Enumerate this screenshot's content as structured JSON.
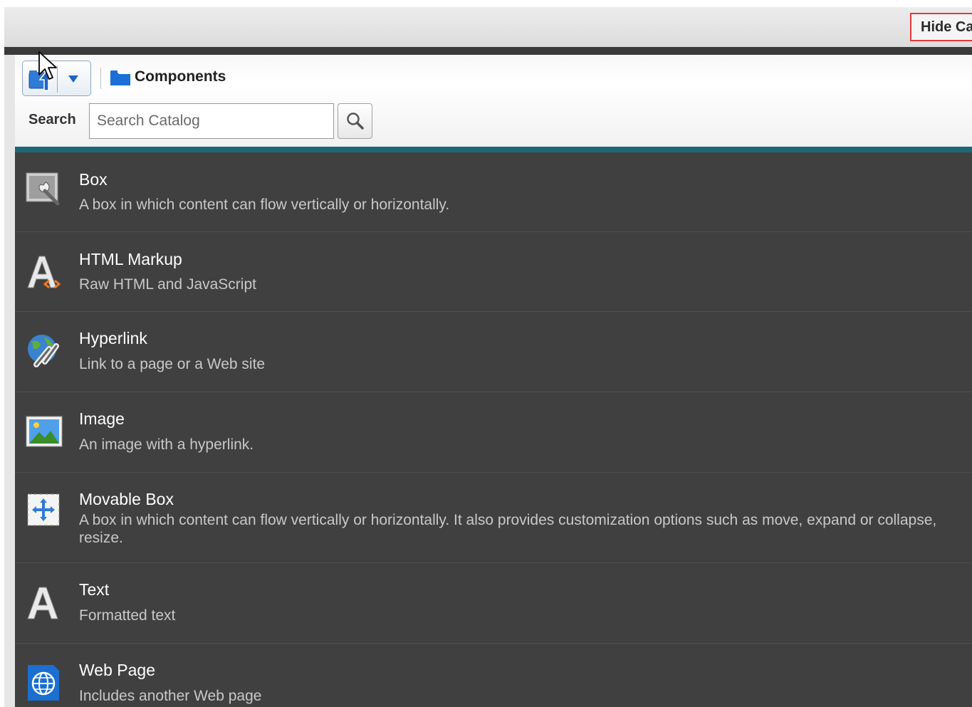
{
  "header": {
    "hide_button_label": "Hide Ca"
  },
  "toolbar": {
    "breadcrumb": "Components",
    "search_label": "Search",
    "search_placeholder": "Search Catalog"
  },
  "items": [
    {
      "title": "Box",
      "desc": "A box in which content can flow vertically or horizontally.",
      "icon": "box-wrench-icon"
    },
    {
      "title": "HTML Markup",
      "desc": "Raw HTML and JavaScript",
      "icon": "html-markup-icon"
    },
    {
      "title": "Hyperlink",
      "desc": "Link to a page or a Web site",
      "icon": "hyperlink-globe-icon"
    },
    {
      "title": "Image",
      "desc": "An image with a hyperlink.",
      "icon": "image-icon"
    },
    {
      "title": "Movable Box",
      "desc": "A box in which content can flow vertically or horizontally. It also provides customization options such as move, expand or collapse, resize.",
      "icon": "movable-box-icon"
    },
    {
      "title": "Text",
      "desc": "Formatted text",
      "icon": "text-icon"
    },
    {
      "title": "Web Page",
      "desc": "Includes another Web page",
      "icon": "web-page-icon"
    }
  ],
  "colors": {
    "list_bg": "#404040",
    "accent_teal": "#1f6675",
    "highlight_red": "#e0393e"
  }
}
